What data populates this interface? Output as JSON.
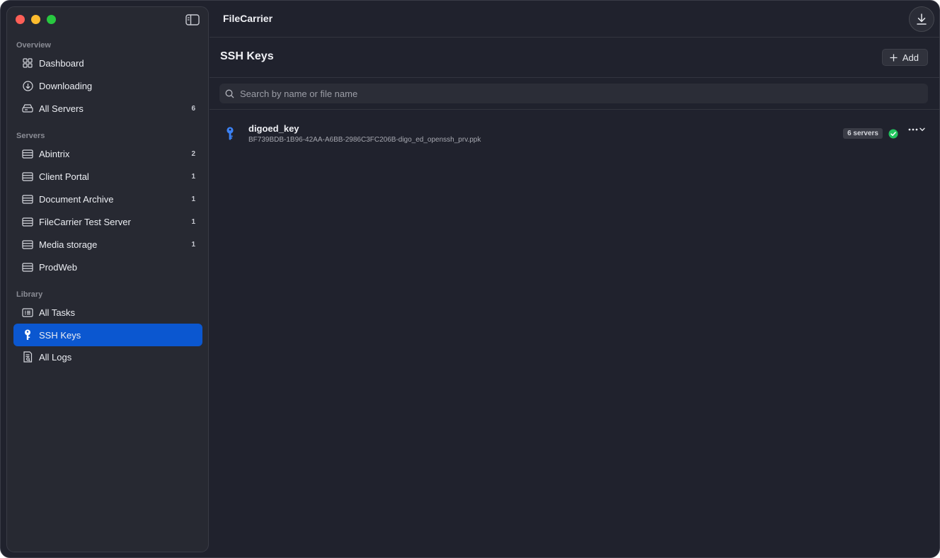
{
  "app": {
    "title": "FileCarrier"
  },
  "sidebar": {
    "sections": {
      "overview": "Overview",
      "servers": "Servers",
      "library": "Library"
    },
    "overview_items": [
      {
        "label": "Dashboard",
        "icon": "grid-icon"
      },
      {
        "label": "Downloading",
        "icon": "download-circle-icon"
      },
      {
        "label": "All Servers",
        "icon": "servers-stack-icon",
        "count": "6"
      }
    ],
    "server_items": [
      {
        "label": "Abintrix",
        "icon": "server-icon",
        "count": "2"
      },
      {
        "label": "Client Portal",
        "icon": "server-icon",
        "count": "1"
      },
      {
        "label": "Document Archive",
        "icon": "server-icon",
        "count": "1"
      },
      {
        "label": "FileCarrier Test Server",
        "icon": "server-icon",
        "count": "1"
      },
      {
        "label": "Media storage",
        "icon": "server-icon",
        "count": "1"
      },
      {
        "label": "ProdWeb",
        "icon": "server-icon"
      }
    ],
    "library_items": [
      {
        "label": "All Tasks",
        "icon": "task-list-icon"
      },
      {
        "label": "SSH Keys",
        "icon": "key-icon",
        "active": true
      },
      {
        "label": "All Logs",
        "icon": "log-document-icon"
      }
    ]
  },
  "main": {
    "page_title": "SSH Keys",
    "add_label": "Add",
    "search_placeholder": "Search by name or file name",
    "search_value": "",
    "keys": [
      {
        "name": "digoed_key",
        "file": "BF739BDB-1B96-42AA-A6BB-2986C3FC206B-digo_ed_openssh_prv.ppk",
        "servers": "6 servers",
        "status": "ok"
      }
    ]
  },
  "colors": {
    "accent": "#0b57d0",
    "background": "#20222d",
    "sidebar": "#272932",
    "success": "#22c55e",
    "key_icon": "#3b82f6"
  }
}
